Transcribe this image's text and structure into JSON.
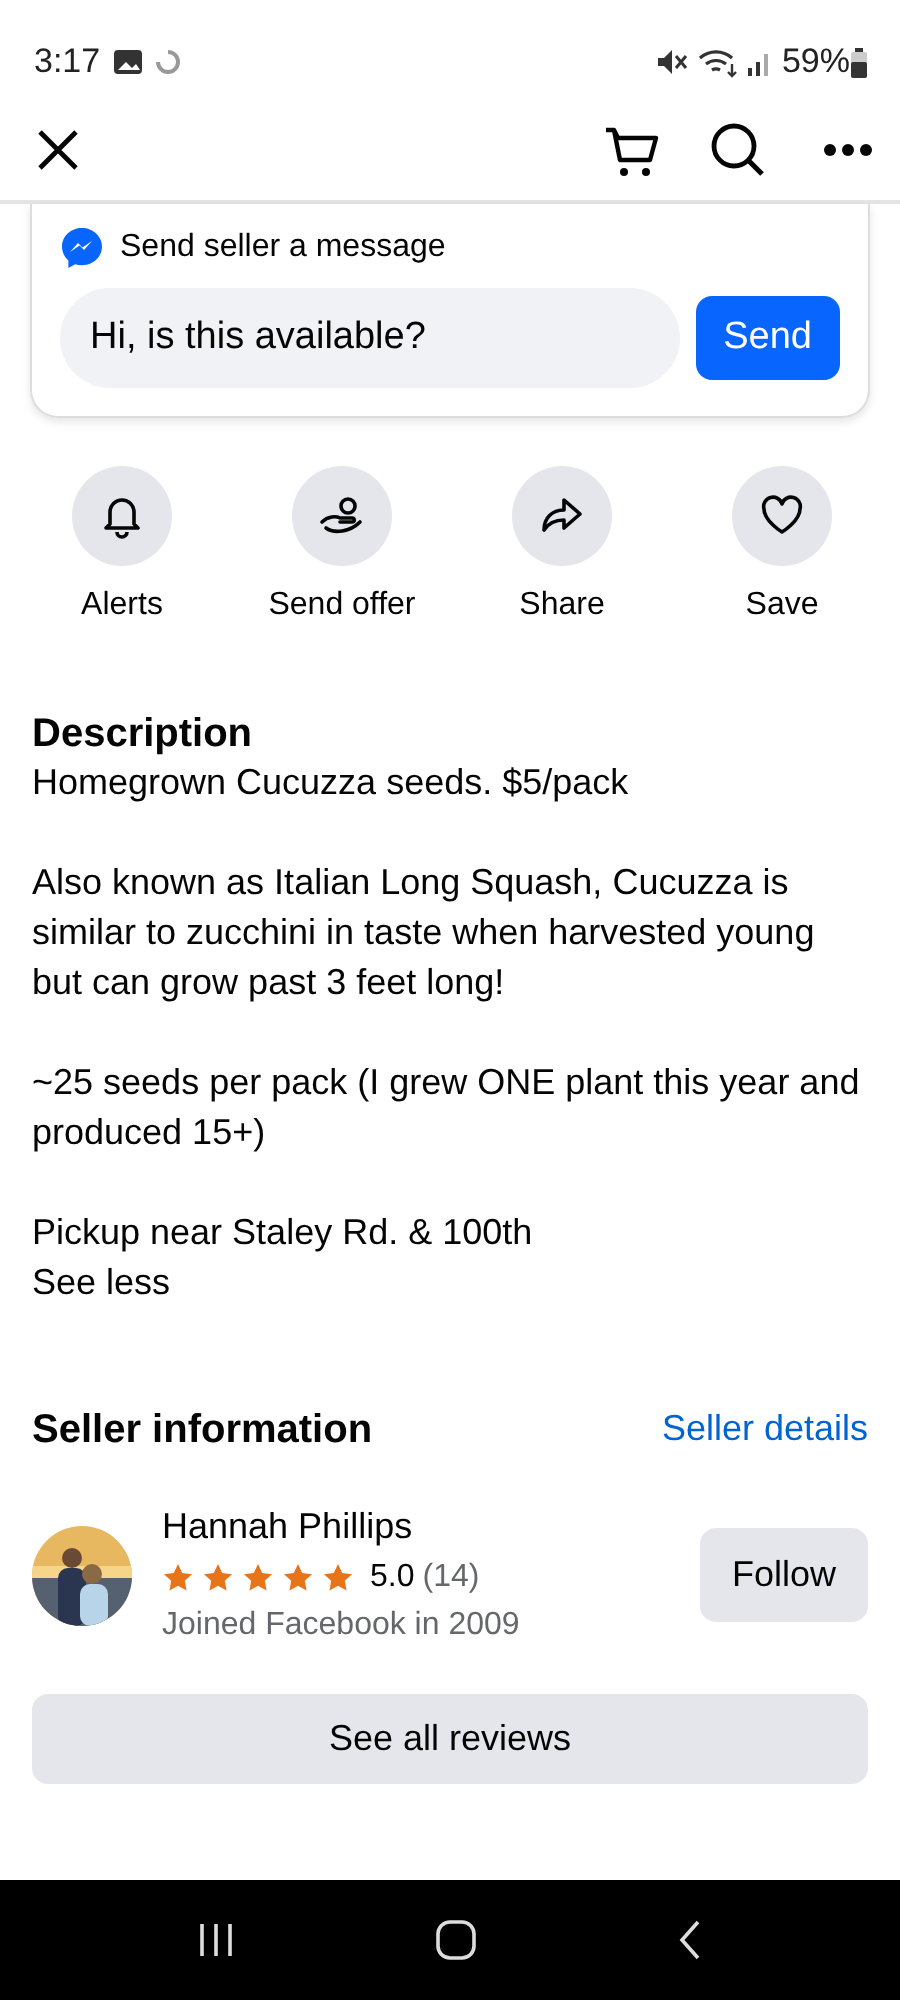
{
  "status_bar": {
    "time": "3:17",
    "battery": "59%"
  },
  "message_box": {
    "title": "Send seller a message",
    "value": "Hi, is this available?",
    "button": "Send"
  },
  "actions": [
    {
      "kind": "bell",
      "label": "Alerts"
    },
    {
      "kind": "offer",
      "label": "Send offer"
    },
    {
      "kind": "share",
      "label": "Share"
    },
    {
      "kind": "heart",
      "label": "Save"
    }
  ],
  "description": {
    "heading": "Description",
    "paragraphs": [
      "Homegrown Cucuzza seeds. $5/pack",
      "Also known as Italian Long Squash, Cucuzza is similar to zucchini in taste when harvested young but can grow past 3 feet long!",
      "~25 seeds per pack (I grew ONE plant this year and produced 15+)",
      "Pickup near Staley Rd. & 100th"
    ],
    "toggle": "See less"
  },
  "seller": {
    "heading": "Seller information",
    "details_link": "Seller details",
    "name": "Hannah Phillips",
    "stars": 5,
    "rating": "5.0",
    "count": "(14)",
    "joined": "Joined Facebook in 2009",
    "follow": "Follow",
    "reviews_button": "See all reviews"
  }
}
